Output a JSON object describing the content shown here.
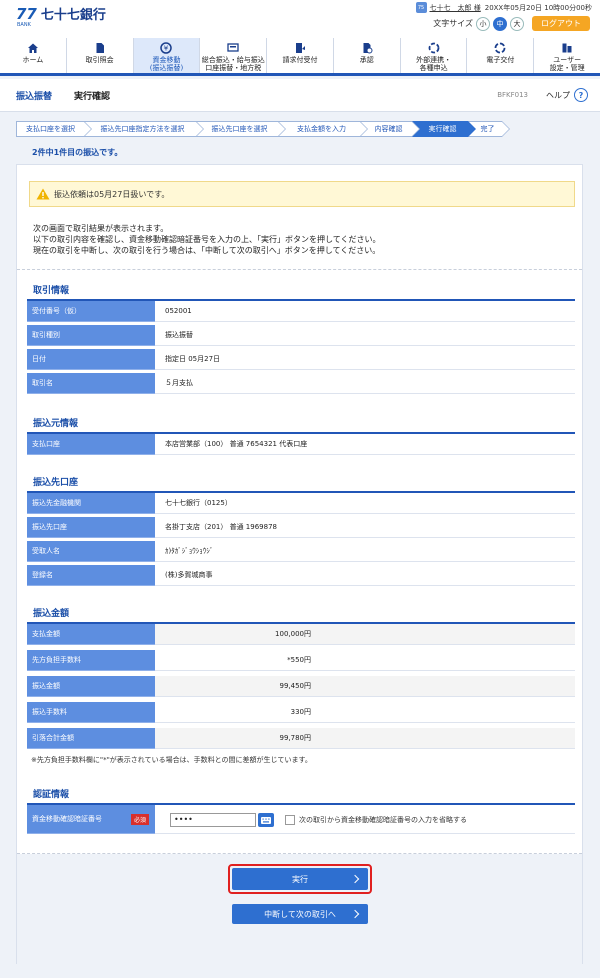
{
  "brand": {
    "mark": "77",
    "mark_sub": "BANK",
    "name": "七十七銀行"
  },
  "user": {
    "badge": "75",
    "name": "七十七　太郎 様",
    "datetime": "20XX年05月20日 10時00分00秒"
  },
  "controls": {
    "font_size_label": "文字サイズ",
    "font_sizes": [
      "小",
      "中",
      "大"
    ],
    "font_size_selected": "中",
    "logout": "ログアウト"
  },
  "nav": [
    {
      "label": "ホーム",
      "icon": "home-icon"
    },
    {
      "label": "取引照会",
      "icon": "document-icon"
    },
    {
      "label": "資金移動\n(振込振替)",
      "icon": "transfer-icon",
      "active": true
    },
    {
      "label": "総合振込・給与振込\n口座振替・地方税",
      "icon": "bulk-transfer-icon"
    },
    {
      "label": "請求付受付",
      "icon": "request-icon"
    },
    {
      "label": "承認",
      "icon": "approval-icon"
    },
    {
      "label": "外部連携・\n各種申込",
      "icon": "link-icon"
    },
    {
      "label": "電子交付",
      "icon": "e-delivery-icon"
    },
    {
      "label": "ユーザー\n設定・管理",
      "icon": "user-settings-icon"
    }
  ],
  "titlebar": {
    "main": "振込振替",
    "sub": "実行確認",
    "code": "BFKF013",
    "help": "ヘルプ",
    "help_icon": "?"
  },
  "steps": [
    "支払口座を選択",
    "振込先口座指定方法を選択",
    "振込先口座を選択",
    "支払金額を入力",
    "内容確認",
    "実行確認",
    "完了"
  ],
  "current_step": 5,
  "count_text": "2件中1件目の振込です。",
  "notice": "振込依頼は05月27日扱いです。",
  "description": [
    "次の画面で取引結果が表示されます。",
    "以下の取引内容を確認し、資金移動確認暗証番号を入力の上、「実行」ボタンを押してください。",
    "現在の取引を中断し、次の取引を行う場合は、「中断して次の取引へ」ボタンを押してください。"
  ],
  "sections": {
    "transaction": {
      "title": "取引情報",
      "rows": [
        {
          "k": "受付番号（仮）",
          "v": "052001"
        },
        {
          "k": "取引種別",
          "v": "振込振替"
        },
        {
          "k": "日付",
          "v": "指定日 05月27日"
        },
        {
          "k": "取引名",
          "v": "５月支払"
        }
      ]
    },
    "source": {
      "title": "振込元情報",
      "rows": [
        {
          "k": "支払口座",
          "v": "本店営業部（100） 普通 7654321 代表口座"
        }
      ]
    },
    "dest": {
      "title": "振込先口座",
      "rows": [
        {
          "k": "振込先金融機関",
          "v": "七十七銀行（0125）"
        },
        {
          "k": "振込先口座",
          "v": "名掛丁支店（201） 普通 1969878"
        },
        {
          "k": "受取人名",
          "v": "ｶ)ﾀｶﾞｼﾞｮｳｼｮｳｼﾞ"
        },
        {
          "k": "登録名",
          "v": "(株)多賀城商事"
        }
      ]
    },
    "amount": {
      "title": "振込金額",
      "rows": [
        {
          "k": "支払金額",
          "v": "100,000円"
        },
        {
          "k": "先方負担手数料",
          "v": "*550円"
        },
        {
          "k": "振込金額",
          "v": "99,450円"
        },
        {
          "k": "振込手数料",
          "v": "330円"
        },
        {
          "k": "引落合計金額",
          "v": "99,780円"
        }
      ]
    },
    "auth": {
      "title": "認証情報",
      "label": "資金移動確認暗証番号",
      "required": "必須",
      "value": "••••",
      "skip_label": "次の取引から資金移動確認暗証番号の入力を省略する"
    }
  },
  "footnote": "※先方負担手数料欄に\"*\"が表示されている場合は、手数料との間に差額が生じています。",
  "buttons": {
    "execute": "実行",
    "suspend_next": "中断して次の取引へ"
  },
  "colors": {
    "primary": "#2e6fd0",
    "header_key": "#5d8ee0",
    "logout": "#f5a623",
    "highlight": "#e02020"
  }
}
